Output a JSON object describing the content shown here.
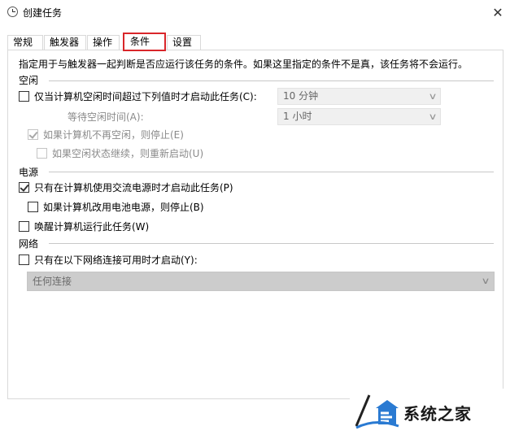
{
  "window": {
    "title": "创建任务",
    "close_glyph": "✕"
  },
  "tabs": [
    {
      "label": "常规",
      "active": false
    },
    {
      "label": "触发器",
      "active": false
    },
    {
      "label": "操作",
      "active": false
    },
    {
      "label": "条件",
      "active": true
    },
    {
      "label": "设置",
      "active": false
    }
  ],
  "description": "指定用于与触发器一起判断是否应运行该任务的条件。如果这里指定的条件不是真，该任务将不会运行。",
  "idle": {
    "group_label": "空闲",
    "start_if_idle": {
      "label": "仅当计算机空闲时间超过下列值时才启动此任务(C):",
      "checked": false,
      "enabled": true
    },
    "idle_duration": {
      "value": "10 分钟"
    },
    "wait_label": "等待空闲时间(A):",
    "wait_duration": {
      "value": "1 小时"
    },
    "stop_if_not_idle": {
      "label": "如果计算机不再空闲，则停止(E)",
      "checked": true,
      "enabled": false
    },
    "restart_if_resumes": {
      "label": "如果空闲状态继续，则重新启动(U)",
      "checked": false,
      "enabled": false
    }
  },
  "power": {
    "group_label": "电源",
    "ac_only": {
      "label": "只有在计算机使用交流电源时才启动此任务(P)",
      "checked": true,
      "enabled": true
    },
    "stop_on_battery": {
      "label": "如果计算机改用电池电源，则停止(B)",
      "checked": false,
      "enabled": true
    },
    "wake_to_run": {
      "label": "唤醒计算机运行此任务(W)",
      "checked": false,
      "enabled": true
    }
  },
  "network": {
    "group_label": "网络",
    "only_if_network": {
      "label": "只有在以下网络连接可用时才启动(Y):",
      "checked": false,
      "enabled": true
    },
    "connection": {
      "value": "任何连接"
    }
  },
  "watermark": {
    "text": "系统之家"
  },
  "icons": {
    "chevron": "∨"
  }
}
